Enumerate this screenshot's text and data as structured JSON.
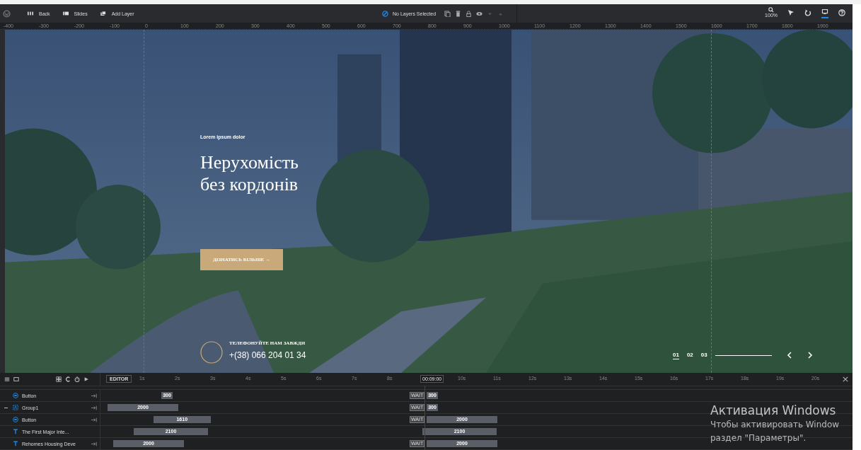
{
  "toolbar": {
    "nav": [
      {
        "label": "Back",
        "kind": "back"
      },
      {
        "label": "Slides",
        "kind": "slides"
      },
      {
        "label": "Add Layer",
        "kind": "add"
      }
    ],
    "selection": "No Layers Selected",
    "tools": [
      {
        "kind": "zoom",
        "label": "100%",
        "selected": false
      },
      {
        "kind": "cursor",
        "selected": false
      },
      {
        "kind": "undo",
        "selected": false
      },
      {
        "kind": "desktop",
        "selected": true
      },
      {
        "kind": "help",
        "selected": false
      }
    ]
  },
  "ruler": [
    "-400",
    "-300",
    "-200",
    "-100",
    "0",
    "100",
    "200",
    "300",
    "400",
    "500",
    "600",
    "700",
    "800",
    "900",
    "1000",
    "1100",
    "1200",
    "1300",
    "1400",
    "1500",
    "1600",
    "1700",
    "1800",
    "1900"
  ],
  "hero": {
    "eyebrow": "Lorem ipsum dolor",
    "title_lines": [
      "Нерухомість",
      "без кордонів"
    ],
    "button": "ДІЗНАТИСЬ БІЛЬШЕ →",
    "phone_label": "ТЕЛЕФОНУЙТЕ НАМ ЗАВЖДИ",
    "phone": "+(38) 066 204 01 34"
  },
  "slider_nav": [
    {
      "label": "01",
      "selected": true
    },
    {
      "label": "02",
      "selected": false
    },
    {
      "label": "03",
      "selected": false
    }
  ],
  "timeline": {
    "mode": "EDITOR",
    "ticks": [
      "1s",
      "2s",
      "3s",
      "4s",
      "5s",
      "6s",
      "7s",
      "8s",
      "10s",
      "11s",
      "12s",
      "13s",
      "14s",
      "15s",
      "16s",
      "17s",
      "18s",
      "19s",
      "20s"
    ],
    "playhead": "00:09:00",
    "rows": [
      {
        "name": "Button",
        "kind": "button",
        "pinned": true,
        "in": "300",
        "wait": "WAIT",
        "out": "300"
      },
      {
        "name": "Group1",
        "kind": "group",
        "expanded": true,
        "pinned": true,
        "in": "2000",
        "wait": "WAIT",
        "out": "300"
      },
      {
        "name": "Button",
        "kind": "button",
        "pinned": true,
        "in": "1610",
        "wait": "WAIT",
        "out": "2000"
      },
      {
        "name": "The First Major Inte...",
        "kind": "text",
        "pinned": false,
        "in": "2100",
        "out": "2100"
      },
      {
        "name": "Rehomes Housing Deve",
        "kind": "text",
        "pinned": true,
        "in": "2000",
        "wait": "WAIT",
        "out": "2000"
      }
    ]
  },
  "os_notice": {
    "title": "Активация Windows",
    "lines": [
      "Чтобы активировать Window",
      "раздел \"Параметры\"."
    ]
  }
}
